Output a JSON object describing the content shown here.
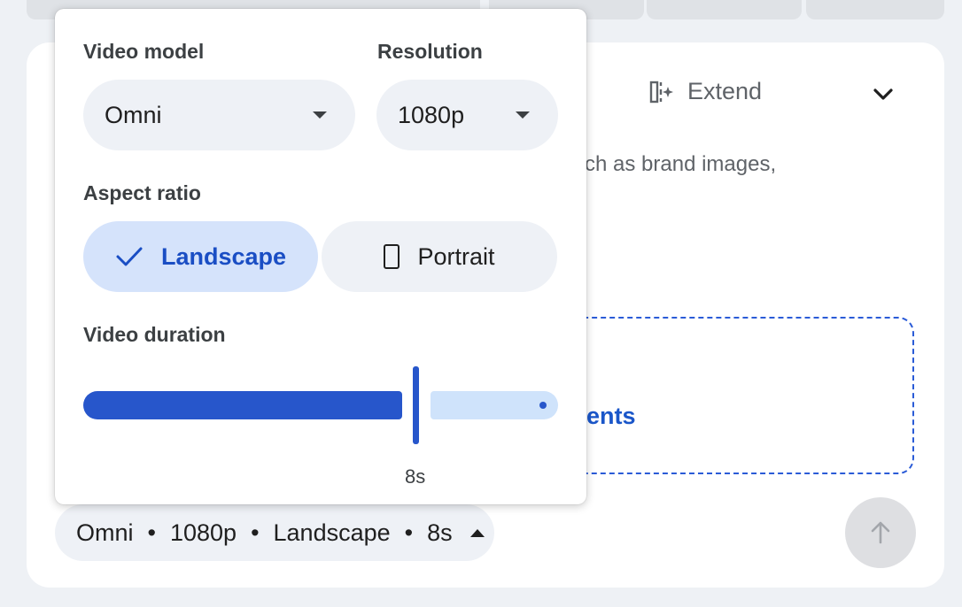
{
  "background": {
    "extend_label": "Extend",
    "hint_text": "ch as brand images,",
    "dropzone_text": "ents"
  },
  "summary_chip": {
    "model": "Omni",
    "sep1": "•",
    "resolution": "1080p",
    "sep2": "•",
    "aspect": "Landscape",
    "sep3": "•",
    "duration": "8s"
  },
  "popover": {
    "video_model": {
      "label": "Video model",
      "value": "Omni"
    },
    "resolution": {
      "label": "Resolution",
      "value": "1080p"
    },
    "aspect_ratio": {
      "label": "Aspect ratio",
      "options": [
        {
          "label": "Landscape",
          "selected": true
        },
        {
          "label": "Portrait",
          "selected": false
        }
      ]
    },
    "video_duration": {
      "label": "Video duration",
      "value_label": "8s"
    }
  },
  "icons": {
    "extend": "extend-icon",
    "chevron": "chevron-down-icon",
    "send": "arrow-up-icon",
    "check": "check-icon",
    "portrait": "portrait-phone-icon"
  },
  "colors": {
    "accent": "#2756cb",
    "selected_bg": "#d5e3fb",
    "chip_bg": "#eef1f6"
  }
}
